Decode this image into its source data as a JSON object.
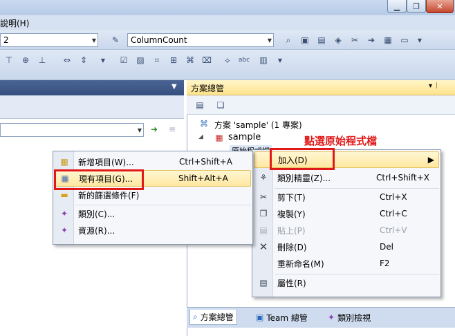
{
  "menubar": {
    "help": "說明(H)"
  },
  "toolbar1": {
    "combo_left_value": "2",
    "combo_right_value": "ColumnCount"
  },
  "solution_explorer": {
    "title": "方案總管",
    "pin_label": "▾ ᛁ",
    "solution_label": "方案 'sample' (1 專案)",
    "project_label": "sample",
    "hidden_folder_label": "原始程式檔"
  },
  "annotation": {
    "text": "點選原始程式檔"
  },
  "context_menu": {
    "items": [
      {
        "label": "加入(D)",
        "shortcut": "",
        "icon": "add-icon",
        "submenu": true
      },
      {
        "label": "類別精靈(Z)...",
        "shortcut": "Ctrl+Shift+X",
        "icon": "class-wizard-icon"
      },
      {
        "label": "剪下(T)",
        "shortcut": "Ctrl+X",
        "icon": "scissors-icon"
      },
      {
        "label": "複製(Y)",
        "shortcut": "Ctrl+C",
        "icon": "copy-icon"
      },
      {
        "label": "貼上(P)",
        "shortcut": "Ctrl+V",
        "icon": "paste-icon",
        "disabled": true
      },
      {
        "label": "刪除(D)",
        "shortcut": "Del",
        "icon": "delete-icon"
      },
      {
        "label": "重新命名(M)",
        "shortcut": "F2",
        "icon": ""
      },
      {
        "label": "屬性(R)",
        "shortcut": "",
        "icon": "properties-icon"
      }
    ]
  },
  "submenu": {
    "items": [
      {
        "label": "新增項目(W)...",
        "shortcut": "Ctrl+Shift+A",
        "icon": "new-item-icon"
      },
      {
        "label": "現有項目(G)...",
        "shortcut": "Shift+Alt+A",
        "icon": "existing-item-icon"
      },
      {
        "label": "新的篩選條件(F)",
        "shortcut": "",
        "icon": "folder-icon"
      },
      {
        "label": "類別(C)...",
        "shortcut": "",
        "icon": "class-icon"
      },
      {
        "label": "資源(R)...",
        "shortcut": "",
        "icon": "resource-icon"
      }
    ]
  },
  "bottom_tabs": [
    {
      "label": "方案總管",
      "icon": "solution-explorer-icon"
    },
    {
      "label": "Team 總管",
      "icon": "team-explorer-icon"
    },
    {
      "label": "類別檢視",
      "icon": "class-view-icon"
    }
  ]
}
